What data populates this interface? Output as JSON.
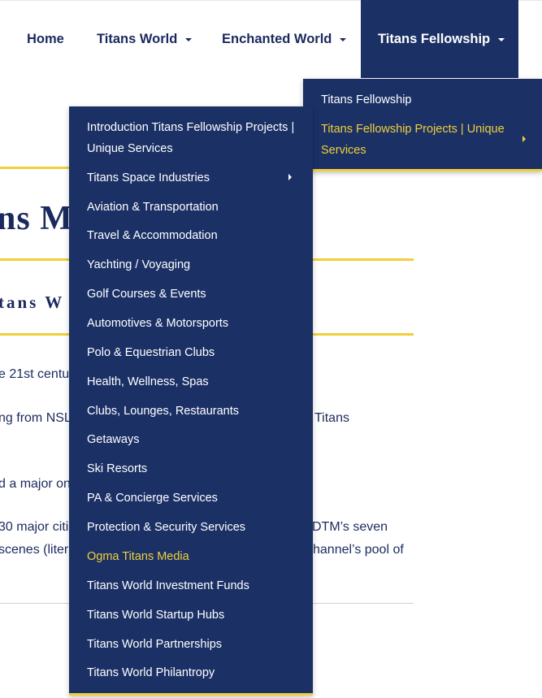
{
  "nav": {
    "home": "Home",
    "titans_world": "Titans World",
    "enchanted_world": "Enchanted World",
    "titans_fellowship": "Titans Fellowship"
  },
  "submenu": {
    "items": [
      {
        "label": "Titans Fellowship"
      },
      {
        "label": "Titans Fellowship Projects | Unique Services",
        "active": true
      }
    ]
  },
  "dropdown": {
    "items": [
      {
        "label": "Introduction Titans Fellowship Projects | Unique Services"
      },
      {
        "label": "Titans Space Industries",
        "has_submenu": true
      },
      {
        "label": "Aviation & Transportation"
      },
      {
        "label": "Travel & Accommodation"
      },
      {
        "label": "Yachting / Voyaging"
      },
      {
        "label": "Golf Courses & Events"
      },
      {
        "label": "Automotives & Motorsports"
      },
      {
        "label": "Polo & Equestrian Clubs"
      },
      {
        "label": "Health, Wellness, Spas"
      },
      {
        "label": "Clubs, Lounges, Restaurants"
      },
      {
        "label": "Getaways"
      },
      {
        "label": "Ski Resorts"
      },
      {
        "label": "PA & Concierge Services"
      },
      {
        "label": "Protection & Security Services"
      },
      {
        "label": "Ogma Titans Media",
        "active": true
      },
      {
        "label": "Titans World Investment Funds"
      },
      {
        "label": "Titans World Startup Hubs"
      },
      {
        "label": "Titans World Partnerships"
      },
      {
        "label": "Titans World Philantropy"
      }
    ]
  },
  "background": {
    "title_fragment": "ns M",
    "subtitle_fragment": "tans W",
    "p1_left": "e 21st centu",
    "p2_left": "ng from NSL",
    "p2_right": "Titans",
    "p3_left": "d a major on",
    "p4_left": "30 major citie",
    "p4_right": "DTM’s seven",
    "p5_left": "scenes (liter",
    "p5_right": "hannel’s pool of"
  },
  "colors": {
    "navy": "#1b3166",
    "text_navy": "#1b2a5e",
    "accent_yellow": "#f0cf3a"
  }
}
